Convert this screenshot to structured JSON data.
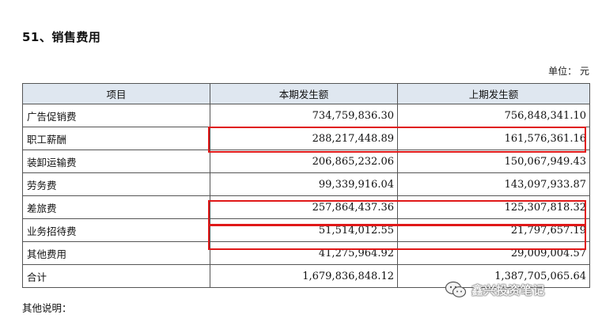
{
  "section": {
    "title": "51、销售费用",
    "unit": "单位： 元"
  },
  "table": {
    "headers": [
      "项目",
      "本期发生额",
      "上期发生额"
    ],
    "rows": [
      {
        "item": "广告促销费",
        "current": "734,759,836.30",
        "previous": "756,848,341.10",
        "highlighted": false
      },
      {
        "item": "职工薪酬",
        "current": "288,217,448.89",
        "previous": "161,576,361.16",
        "highlighted": true
      },
      {
        "item": "装卸运输费",
        "current": "206,865,232.06",
        "previous": "150,067,949.43",
        "highlighted": false
      },
      {
        "item": "劳务费",
        "current": "99,339,916.04",
        "previous": "143,097,933.87",
        "highlighted": false
      },
      {
        "item": "差旅费",
        "current": "257,864,437.36",
        "previous": "125,307,818.32",
        "highlighted": true
      },
      {
        "item": "业务招待费",
        "current": "51,514,012.55",
        "previous": "21,797,657.19",
        "highlighted": true
      },
      {
        "item": "其他费用",
        "current": "41,275,964.92",
        "previous": "29,009,004.57",
        "highlighted": false
      },
      {
        "item": "合计",
        "current": "1,679,836,848.12",
        "previous": "1,387,705,065.64",
        "highlighted": false
      }
    ]
  },
  "note": "其他说明：",
  "watermark": {
    "text": "鑫兴投资笔记",
    "icon": "wechat-icon"
  },
  "colors": {
    "header_bg": "#dfe7f0",
    "highlight": "#e01818"
  }
}
